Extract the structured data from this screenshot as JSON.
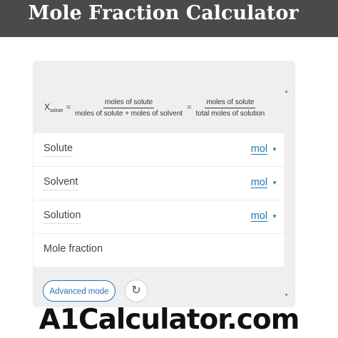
{
  "header": {
    "title": "Mole Fraction Calculator"
  },
  "formula": {
    "variable": "X",
    "subscript": "solute",
    "equals": "=",
    "fraction1": {
      "numerator": "moles of solute",
      "denominator": "moles of solute + moles of solvent"
    },
    "fraction2": {
      "numerator": "moles of solute",
      "denominator": "total moles of solution"
    }
  },
  "scrollbar": {
    "up_icon": "triangle-up-icon",
    "down_icon": "triangle-down-icon"
  },
  "fields": [
    {
      "label": "Solute",
      "unit": "mol"
    },
    {
      "label": "Solvent",
      "unit": "mol"
    },
    {
      "label": "Solution",
      "unit": "mol"
    },
    {
      "label": "Mole fraction"
    }
  ],
  "buttons": {
    "advanced_mode": "Advanced mode",
    "reset_icon": "refresh-icon"
  },
  "watermark": "A1Calculator.com",
  "colors": {
    "banner": "#4a4a4a",
    "accent": "#1f78b4",
    "widget_bg": "#efefef"
  }
}
